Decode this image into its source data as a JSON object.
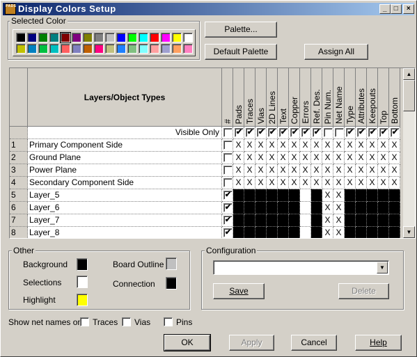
{
  "window": {
    "title": "Display Colors Setup",
    "icon_text": "PADS"
  },
  "selected_color": {
    "label": "Selected Color",
    "selected_index": 4,
    "row1": [
      "#000000",
      "#000080",
      "#008000",
      "#008080",
      "#800000",
      "#800080",
      "#808000",
      "#808080",
      "#c0c0c0",
      "#0000ff",
      "#00ff00",
      "#00ffff",
      "#ff0000",
      "#ff00ff",
      "#ffff00",
      "#ffffff"
    ],
    "row2": [
      "#c0c000",
      "#0080c0",
      "#00c040",
      "#00c0c0",
      "#ff6060",
      "#8080c0",
      "#c06000",
      "#ff0080",
      "#c0c080",
      "#2080ff",
      "#80c080",
      "#80ffff",
      "#ffa0a0",
      "#a0a0d0",
      "#ffa060",
      "#ff80c0"
    ]
  },
  "buttons": {
    "palette": "Palette...",
    "default_palette": "Default Palette",
    "assign_all": "Assign All",
    "save": "Save",
    "delete": "Delete",
    "ok": "OK",
    "apply": "Apply",
    "cancel": "Cancel",
    "help": "Help"
  },
  "grid": {
    "name_header": "Layers/Object Types",
    "num_header": "#",
    "columns": [
      "Pads",
      "Traces",
      "Vias",
      "2D Lines",
      "Text",
      "Copper",
      "Errors",
      "Ref. Des.",
      "Pin Num.",
      "Net Name",
      "Type",
      "Attributes",
      "Keepouts",
      "Top",
      "Bottom"
    ],
    "visible_only": {
      "label": "Visible Only",
      "num_checked": false,
      "checked": [
        true,
        true,
        true,
        true,
        true,
        true,
        true,
        true,
        false,
        false,
        true,
        true,
        true,
        true,
        true
      ]
    },
    "rows": [
      {
        "num": "1",
        "name": "Primary Component Side",
        "checked": false,
        "cells": [
          "x",
          "x",
          "x",
          "x",
          "x",
          "x",
          "x",
          "x",
          "x",
          "x",
          "x",
          "x",
          "x",
          "x",
          "x"
        ]
      },
      {
        "num": "2",
        "name": "Ground Plane",
        "checked": false,
        "cells": [
          "x",
          "x",
          "x",
          "x",
          "x",
          "x",
          "x",
          "x",
          "x",
          "x",
          "x",
          "x",
          "x",
          "x",
          "x"
        ]
      },
      {
        "num": "3",
        "name": "Power Plane",
        "checked": false,
        "cells": [
          "x",
          "x",
          "x",
          "x",
          "x",
          "x",
          "x",
          "x",
          "x",
          "x",
          "x",
          "x",
          "x",
          "x",
          "x"
        ]
      },
      {
        "num": "4",
        "name": "Secondary Component Side",
        "checked": false,
        "cells": [
          "x",
          "x",
          "x",
          "x",
          "x",
          "x",
          "x",
          "x",
          "x",
          "x",
          "x",
          "x",
          "x",
          "x",
          "x"
        ]
      },
      {
        "num": "5",
        "name": "Layer_5",
        "checked": true,
        "cells": [
          "#000000",
          "#000000",
          "#000000",
          "#000000",
          "#000000",
          "#000000",
          "#ffffff",
          "#000000",
          "x",
          "x",
          "#000000",
          "#000000",
          "#000000",
          "#000000",
          "#000000"
        ]
      },
      {
        "num": "6",
        "name": "Layer_6",
        "checked": true,
        "cells": [
          "#000000",
          "#000000",
          "#000000",
          "#000000",
          "#000000",
          "#000000",
          "#ffffff",
          "#000000",
          "x",
          "x",
          "#000000",
          "#000000",
          "#000000",
          "#000000",
          "#000000"
        ]
      },
      {
        "num": "7",
        "name": "Layer_7",
        "checked": true,
        "cells": [
          "#000000",
          "#000000",
          "#000000",
          "#000000",
          "#000000",
          "#000000",
          "#ffffff",
          "#000000",
          "x",
          "x",
          "#000000",
          "#000000",
          "#000000",
          "#000000",
          "#000000"
        ]
      },
      {
        "num": "8",
        "name": "Layer_8",
        "checked": true,
        "cells": [
          "#000000",
          "#000000",
          "#000000",
          "#000000",
          "#000000",
          "#000000",
          "#ffffff",
          "#000000",
          "x",
          "x",
          "#000000",
          "#000000",
          "#000000",
          "#000000",
          "#000000"
        ]
      }
    ]
  },
  "other": {
    "label": "Other",
    "background": {
      "label": "Background",
      "color": "#000000"
    },
    "selections": {
      "label": "Selections",
      "color": "#ffffff"
    },
    "highlight": {
      "label": "Highlight",
      "color": "#ffff00"
    },
    "board_outline": {
      "label": "Board Outline",
      "color": "#c0c0c0"
    },
    "connection": {
      "label": "Connection",
      "color": "#000000"
    }
  },
  "configuration": {
    "label": "Configuration",
    "value": ""
  },
  "net_names": {
    "label": "Show net names on",
    "traces": "Traces",
    "vias": "Vias",
    "pins": "Pins",
    "traces_checked": false,
    "vias_checked": false,
    "pins_checked": false
  }
}
